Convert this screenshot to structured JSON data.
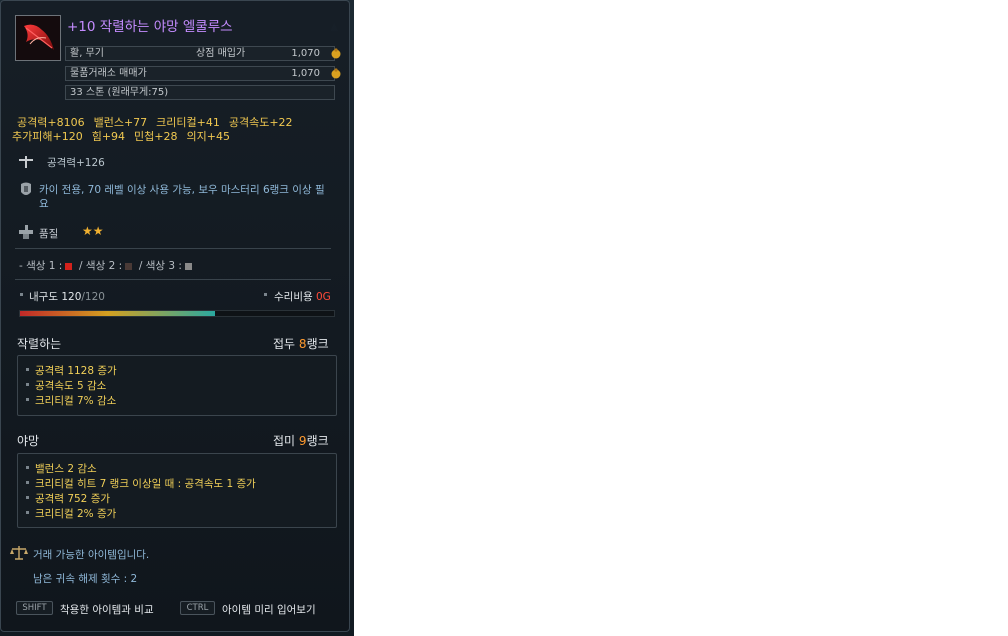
{
  "item": {
    "name": "+10 작렬하는 야망 엘쿨루스",
    "category": "활, 무기",
    "shop_price_label": "상점 매입가",
    "shop_price": "1,070",
    "market_label": "물품거래소 매매가",
    "market_price": "1,070",
    "weight": "33 스톤 (원래무게:75)"
  },
  "stats": {
    "row1": [
      "공격력+8106",
      "밸런스+77",
      "크리티컬+41",
      "공격속도+22"
    ],
    "row2": [
      "추가피해+120",
      "힘+94",
      "민첩+28",
      "의지+45"
    ]
  },
  "attack_line": "공격력+126",
  "requirement": "카이 전용, 70 레벨 이상 사용 가능, 보우 마스터리 6랭크 이상 필요",
  "quality": {
    "label": "품질",
    "stars": "★★"
  },
  "colors": {
    "label1": "- 색상 1 :",
    "label2": "/ 색상 2 :",
    "label3": "/ 색상 3 :",
    "c1": "#d4221c",
    "c2": "#4a3a36",
    "c3": "#8a8a8a"
  },
  "durability": {
    "label": "내구도",
    "current": "120",
    "max": "/120",
    "repair_label": "수리비용",
    "repair_cost": "0G",
    "fill": 0.62
  },
  "enchant1": {
    "name": "작렬하는",
    "rank_prefix": "접두",
    "rank_num": "8",
    "rank_suffix": "랭크",
    "effects": [
      "공격력 1128 증가",
      "공격속도 5 감소",
      "크리티컬 7% 감소"
    ]
  },
  "enchant2": {
    "name": "야망",
    "rank_prefix": "접미",
    "rank_num": "9",
    "rank_suffix": "랭크",
    "effects": [
      "밸런스 2 감소",
      "크리티컬 히트 7 랭크 이상일 때 : 공격속도 1 증가",
      "공격력 752 증가",
      "크리티컬 2% 증가"
    ]
  },
  "trade": {
    "tradeable": "거래 가능한 아이템입니다.",
    "bind_remaining": "남은 귀속 해제 횟수 : 2"
  },
  "hotkeys": {
    "shift_key": "SHIFT",
    "shift_label": "착용한 아이템과 비교",
    "ctrl_key": "CTRL",
    "ctrl_label": "아이템 미리 입어보기"
  },
  "accent": {
    "gold": "#f0c850",
    "purple": "#c48cff",
    "orange": "#ff9a2e"
  }
}
